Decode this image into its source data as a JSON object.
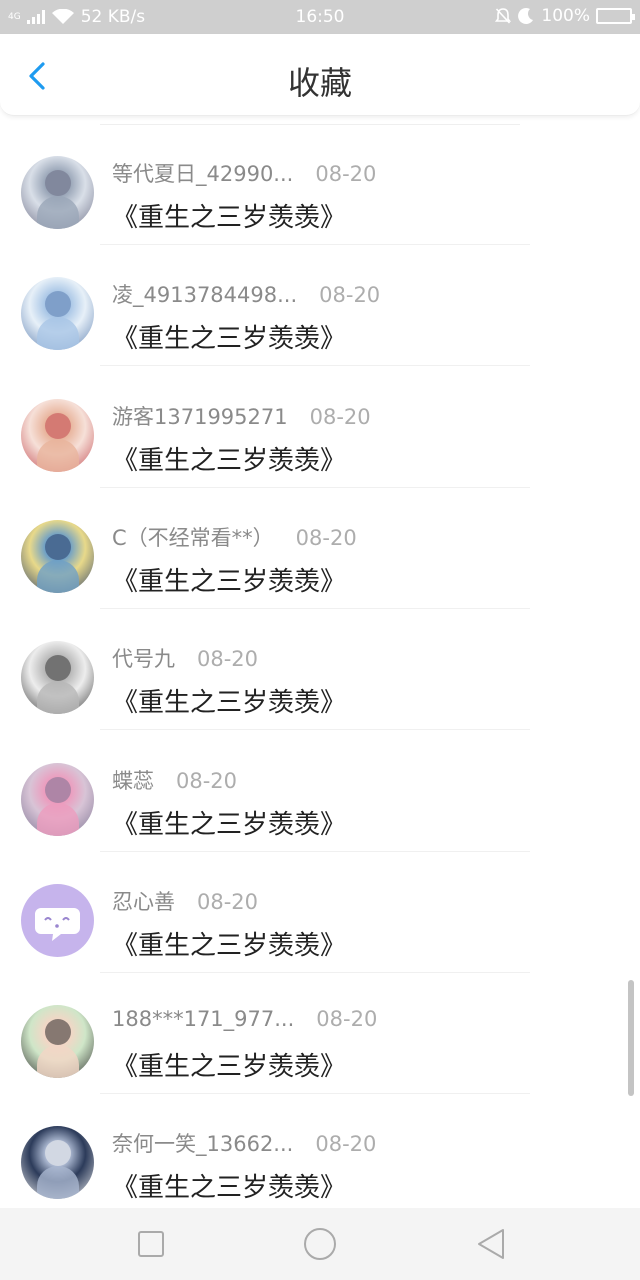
{
  "status_bar": {
    "network_type": "4G",
    "speed": "52 KB/s",
    "time": "16:50",
    "battery": "100%",
    "icons": [
      "signal-icon",
      "wifi-icon",
      "mute-icon",
      "moon-icon",
      "battery-icon"
    ]
  },
  "header": {
    "title": "收藏",
    "back_icon": "chevron-left-icon",
    "accent_color": "#1e9bf0"
  },
  "favorites": [
    {
      "name": "等代夏日_42990...",
      "date": "08-20",
      "book": "《重生之三岁羡羡》",
      "avatar_colors": [
        "#d9dfe8",
        "#9aa6b8",
        "#6d6f86"
      ]
    },
    {
      "name": "凌_4913784498...",
      "date": "08-20",
      "book": "《重生之三岁羡羡》",
      "avatar_colors": [
        "#e7f0f8",
        "#a9c6e6",
        "#5c7fb0"
      ]
    },
    {
      "name": "游客1371995271",
      "date": "08-20",
      "book": "《重生之三岁羡羡》",
      "avatar_colors": [
        "#f6e0d8",
        "#e8b49c",
        "#c24a52"
      ]
    },
    {
      "name": "C（不经常看**）",
      "date": "08-20",
      "book": "《重生之三岁羡羡》",
      "avatar_colors": [
        "#e8d98a",
        "#6fa0c6",
        "#2b3f6a"
      ]
    },
    {
      "name": "代号九",
      "date": "08-20",
      "book": "《重生之三岁羡羡》",
      "avatar_colors": [
        "#ededed",
        "#b6b6b6",
        "#3b3b3b"
      ]
    },
    {
      "name": "蝶蕊",
      "date": "08-20",
      "book": "《重生之三岁羡羡》",
      "avatar_colors": [
        "#d8c4d6",
        "#ec9cbe",
        "#7b7392"
      ]
    },
    {
      "name": "忍心善",
      "date": "08-20",
      "book": "《重生之三岁羡羡》",
      "avatar_colors": [
        "#c6b4ec",
        "#c6b4ec",
        "#ffffff"
      ],
      "avatar_type": "chat-bubble-icon"
    },
    {
      "name": "188***171_977...",
      "date": "08-20",
      "book": "《重生之三岁羡羡》",
      "avatar_colors": [
        "#cfe6c8",
        "#f3d6c6",
        "#2b2b2b"
      ]
    },
    {
      "name": "奈何一笑_13662...",
      "date": "08-20",
      "book": "《重生之三岁羡羡》",
      "avatar_colors": [
        "#2c3b5a",
        "#a9b6cf",
        "#f4f4f4"
      ]
    }
  ],
  "nav_bar": {
    "icons": [
      "recent-apps-icon",
      "home-icon",
      "back-icon"
    ]
  }
}
